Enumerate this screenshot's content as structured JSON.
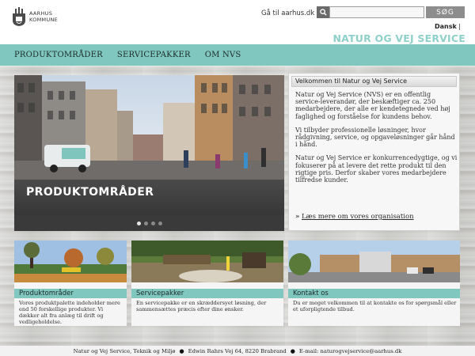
{
  "header": {
    "logo_line1": "AARHUS",
    "logo_line2": "KOMMUNE",
    "goto_link": "Gå til aarhus.dk",
    "search": {
      "placeholder": "",
      "button_label": "SØG"
    },
    "language": "Dansk",
    "lang_separator": "|",
    "brand": "NATUR OG VEJ SERVICE"
  },
  "nav": {
    "items": [
      "PRODUKTOMRÅDER",
      "SERVICEPAKKER",
      "OM NVS"
    ]
  },
  "hero": {
    "caption": "PRODUKTOMRÅDER",
    "slide_count": 4,
    "active_slide": 1
  },
  "welcome": {
    "title": "Velkommen til Natur og Vej Service",
    "paragraphs": [
      "Natur og Vej Service (NVS) er en offentlig service-leverandør, der beskæftiger ca. 250 medarbejdere, der alle er kendetegnede ved høj faglighed og forståelse for kundens behov.",
      "Vi tilbyder professionelle løsninger, hvor rådgivning, service, og opgaveløsninger går hånd i hånd.",
      "Natur og Vej Service er konkurrencedygtige, og vi fokuserer på at levere det rette produkt til den rigtige pris. Derfor skaber vores medarbejdere tilfredse kunder."
    ],
    "link_arrow": "»",
    "link_label": "Læs mere om vores organisation"
  },
  "cards": [
    {
      "title": "Produktområder",
      "text": "Vores produktpalette indeholder mere end 50 forskellige produkter. Vi dækker alt fra anlæg til drift og vedligeholdelse."
    },
    {
      "title": "Servicepakker",
      "text": "En servicepakke er en skræddersyet løsning, der sammensættes præcis efter dine ønsker."
    },
    {
      "title": "Kontakt os",
      "text": "Du er meget velkommen til at kontakte os for spørgsmål eller et uforpligtende tilbud."
    }
  ],
  "footer": {
    "part1": "Natur og Vej Service, Teknik og Miljø",
    "part2": "Edwin Rahrs Vej 64, 8220 Brabrand",
    "part3": "E-mail: naturogvejservice@aarhus.dk",
    "bullet": "●"
  },
  "colors": {
    "accent": "#80c7bf",
    "brand_text": "#8fd0c9",
    "search_button": "#8d8d8d"
  },
  "icons": [
    "city-seal-icon",
    "search-icon",
    "arrow-right-icon"
  ]
}
